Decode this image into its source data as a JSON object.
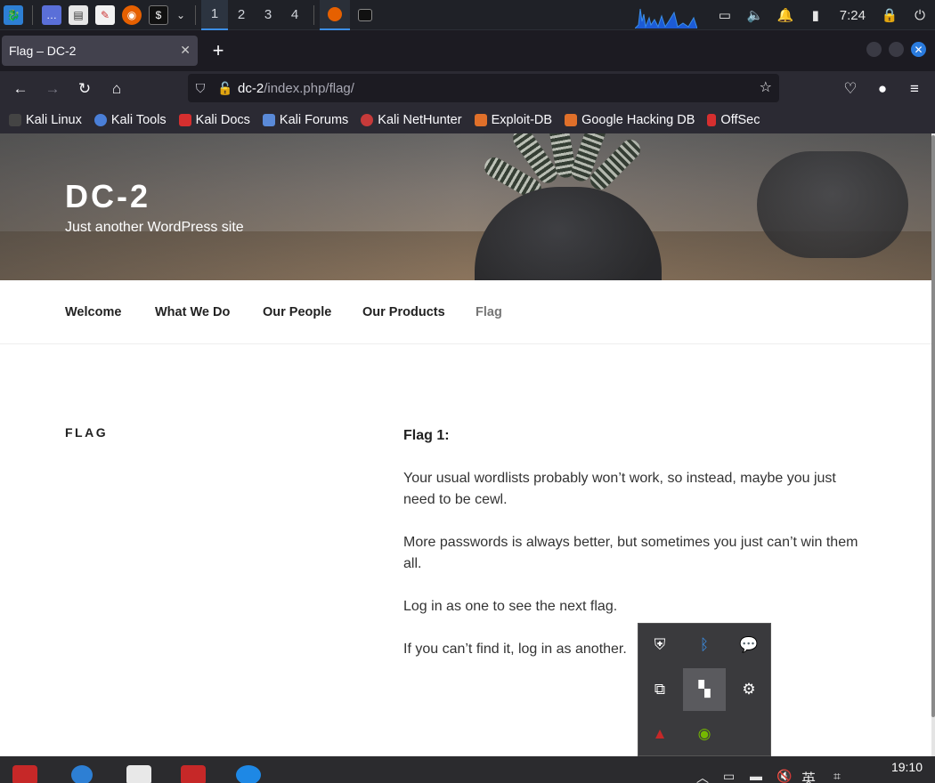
{
  "kali_panel": {
    "workspaces": [
      "1",
      "2",
      "3",
      "4"
    ],
    "active_workspace": "1",
    "clock": "7:24"
  },
  "browser": {
    "tab_title": "Flag – DC-2",
    "url_host": "dc-2",
    "url_path": "/index.php/flag/",
    "bookmarks": [
      "Kali Linux",
      "Kali Tools",
      "Kali Docs",
      "Kali Forums",
      "Kali NetHunter",
      "Exploit-DB",
      "Google Hacking DB",
      "OffSec"
    ]
  },
  "site": {
    "title": "DC-2",
    "description": "Just another WordPress site",
    "menu": [
      "Welcome",
      "What We Do",
      "Our People",
      "Our Products",
      "Flag"
    ],
    "current_menu": "Flag"
  },
  "post": {
    "title": "FLAG",
    "heading": "Flag 1:",
    "paragraphs": [
      "Your usual wordlists probably won’t work, so instead, maybe you just need to be cewl.",
      "More passwords is always better, but sometimes you just can’t win them all.",
      "Log in as one to see the next flag.",
      "If you can’t find it, log in as another."
    ]
  },
  "taskbar": {
    "ime": "英",
    "clock": "19:10"
  },
  "colors": {
    "accent": "#3b8ee6",
    "firefox_bg": "#2b2a33"
  }
}
